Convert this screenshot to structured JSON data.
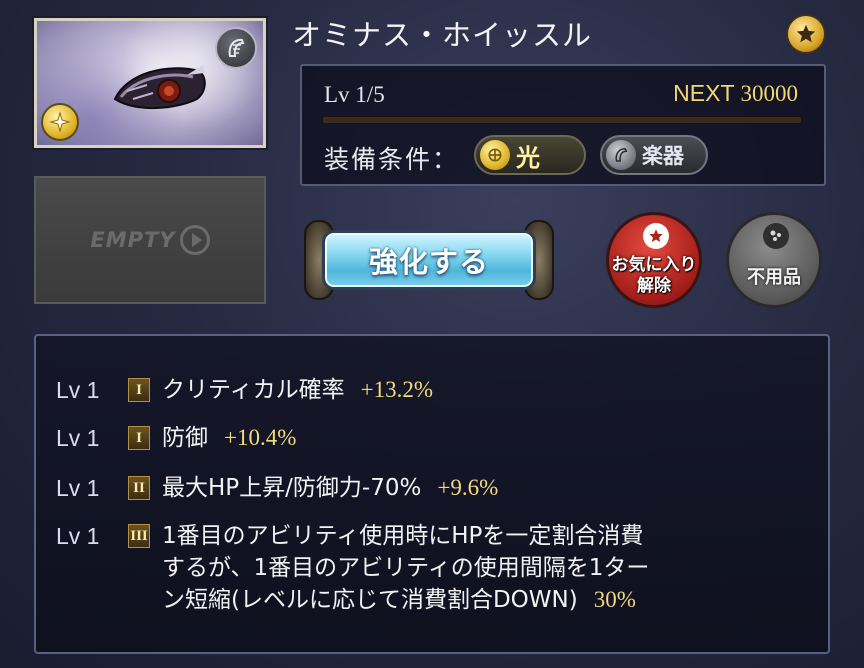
{
  "weapon": {
    "name": "オミナス・ホイッスル",
    "element": "light",
    "weapon_type": "harp",
    "rarity_icon": "star-icon"
  },
  "empty_slot": {
    "label": "EMPTY"
  },
  "level": {
    "current_label": "Lv 1/5",
    "next_label": "NEXT",
    "next_value": "30000",
    "exp_progress": 0
  },
  "requirements": {
    "label": "装備条件：",
    "element_label": "光",
    "type_label": "楽器"
  },
  "actions": {
    "upgrade_label": "強化する",
    "favorite_remove_label_1": "お気に入り",
    "favorite_remove_label_2": "解除",
    "unused_label": "不用品"
  },
  "skills": [
    {
      "lv": "Lv 1",
      "tier": "I",
      "text": "クリティカル確率",
      "value": "+13.2%"
    },
    {
      "lv": "Lv 1",
      "tier": "I",
      "text": "防御",
      "value": "+10.4%"
    },
    {
      "lv": "Lv 1",
      "tier": "II",
      "text": "最大HP上昇/防御力-70%",
      "value": "+9.6%"
    },
    {
      "lv": "Lv 1",
      "tier": "III",
      "text_line1": "1番目のアビリティ使用時にHPを一定割合消費",
      "text_line2": "するが、1番目のアビリティの使用間隔を1ター",
      "text_line3": "ン短縮(レベルに応じて消費割合DOWN)",
      "value": "30%"
    }
  ],
  "colors": {
    "accent_gold": "#f3da7c",
    "button_blue": "#8fdcf3",
    "favorite_red": "#a8201c",
    "unused_gray": "#5c5c5c"
  }
}
